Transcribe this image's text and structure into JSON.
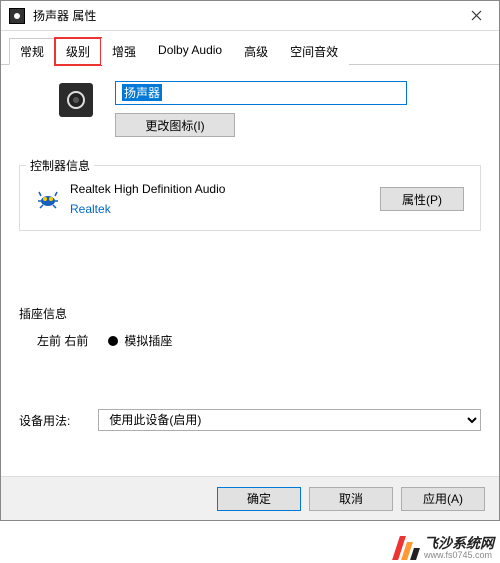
{
  "window": {
    "title": "扬声器 属性"
  },
  "tabs": [
    "常规",
    "级别",
    "增强",
    "Dolby Audio",
    "高级",
    "空间音效"
  ],
  "active_tab_index": 0,
  "highlighted_tab_index": 1,
  "device": {
    "name": "扬声器",
    "change_icon_label": "更改图标(I)"
  },
  "controller": {
    "group_label": "控制器信息",
    "name": "Realtek High Definition Audio",
    "vendor": "Realtek",
    "properties_label": "属性(P)"
  },
  "jack": {
    "group_label": "插座信息",
    "position": "左前 右前",
    "type": "模拟插座"
  },
  "usage": {
    "label": "设备用法:",
    "value": "使用此设备(启用)"
  },
  "footer": {
    "ok": "确定",
    "cancel": "取消",
    "apply": "应用(A)"
  },
  "watermark": {
    "text": "飞沙系统网",
    "url": "www.fs0745.com"
  }
}
